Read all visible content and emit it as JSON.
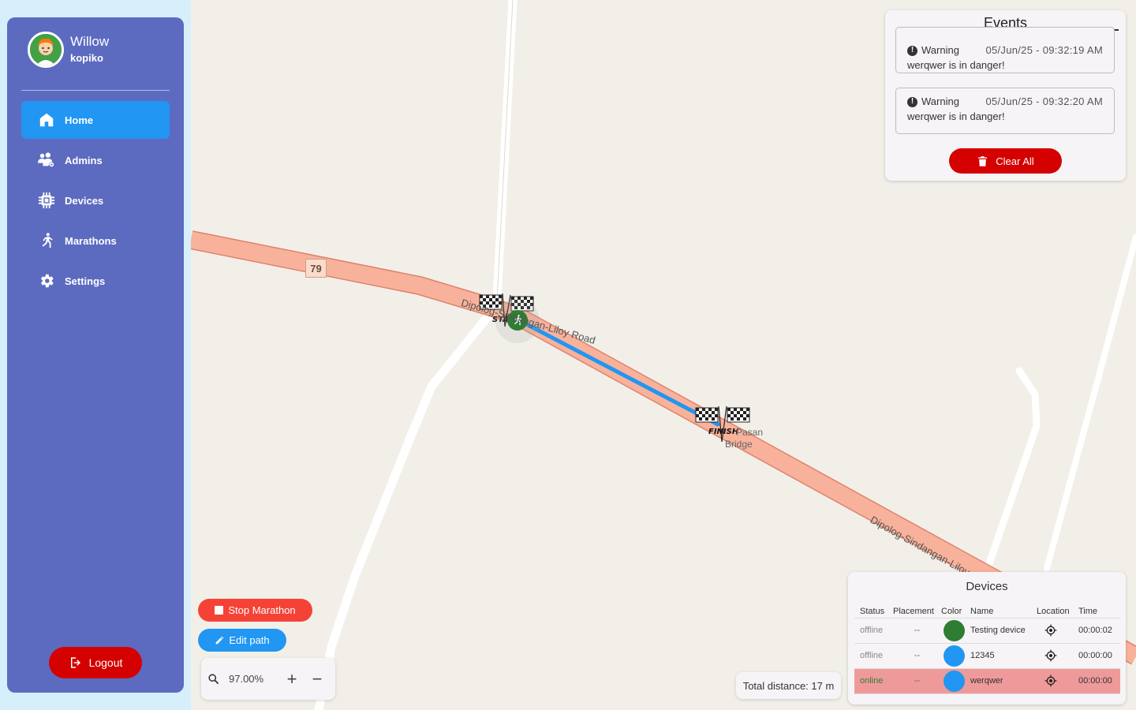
{
  "user": {
    "name": "Willow",
    "username": "kopiko"
  },
  "nav": [
    {
      "label": "Home",
      "icon": "home-icon",
      "active": true
    },
    {
      "label": "Admins",
      "icon": "admins-icon"
    },
    {
      "label": "Devices",
      "icon": "chip-icon"
    },
    {
      "label": "Marathons",
      "icon": "runner-icon"
    },
    {
      "label": "Settings",
      "icon": "gear-icon"
    }
  ],
  "logout_label": "Logout",
  "events": {
    "title": "Events",
    "items": [
      {
        "level": "Warning",
        "time": "05/Jun/25 - 09:32:19 AM",
        "message": "werqwer is in danger!"
      },
      {
        "level": "Warning",
        "time": "05/Jun/25 - 09:32:20 AM",
        "message": "werqwer is in danger!"
      }
    ],
    "clear_label": "Clear All"
  },
  "map": {
    "route_number": "79",
    "road_name_1": "Dipolog-Sindangan-Liloy Road",
    "road_name_2": "Dipolog-Sindangan-Liloy",
    "bridge_label_1": "Pasan",
    "bridge_label_2": "Bridge",
    "start_label": "START",
    "finish_label": "FINISH"
  },
  "controls": {
    "stop_label": "Stop Marathon",
    "edit_label": "Edit path",
    "zoom_value": "97.00%",
    "zoom_in": "+",
    "zoom_out": "−"
  },
  "total_distance": "Total distance: 17 m",
  "devices": {
    "title": "Devices",
    "columns": [
      "Status",
      "Placement",
      "Color",
      "Name",
      "Location",
      "Time"
    ],
    "rows": [
      {
        "status": "offline",
        "placement": "--",
        "color": "#2e7d32",
        "name": "Testing device",
        "time": "00:00:02"
      },
      {
        "status": "offline",
        "placement": "--",
        "color": "#2196f3",
        "name": "12345",
        "time": "00:00:00"
      },
      {
        "status": "online",
        "placement": "--",
        "color": "#2196f3",
        "name": "werqwer",
        "time": "00:00:00"
      }
    ]
  },
  "colors": {
    "sidebar": "#5c6bc0",
    "accent": "#2196f3",
    "danger": "#d50000",
    "road": "#f9b29c"
  }
}
